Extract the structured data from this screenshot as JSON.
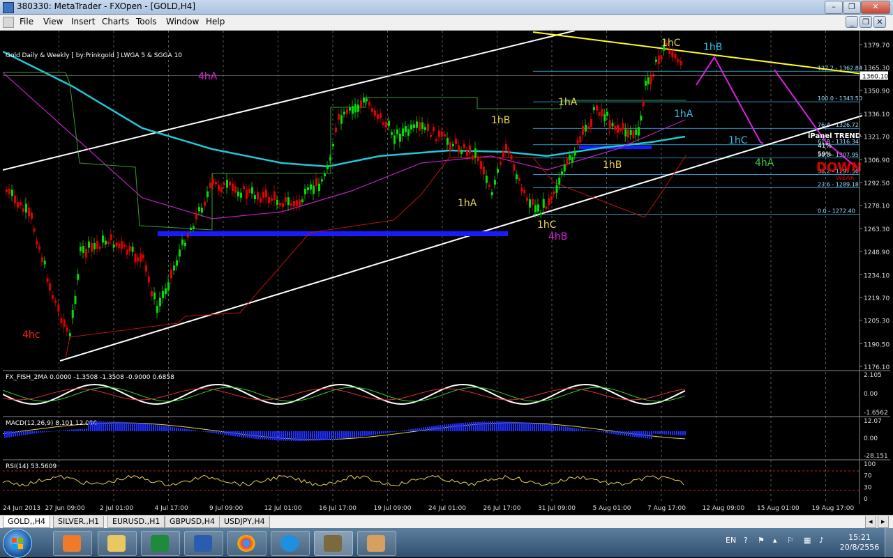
{
  "window": {
    "title": "380330: MetaTrader - FXOpen - [GOLD,H4]"
  },
  "menu": [
    "File",
    "View",
    "Insert",
    "Charts",
    "Tools",
    "Window",
    "Help"
  ],
  "chart": {
    "header": "Gold Daily & Weekly [ by:Prinkgold ] LWGA 5 & SGGA 10",
    "price_labels": [
      "1379.70",
      "1365.30",
      "1350.90",
      "1336.10",
      "1321.70",
      "1306.90",
      "1292.50",
      "1278.10",
      "1263.30",
      "1248.90",
      "1234.10",
      "1219.70",
      "1205.30",
      "1190.50",
      "1176.10"
    ],
    "current_price": "1360.10",
    "fib_levels": [
      {
        "label": "127.2 - 1362.84",
        "price": 1362.84
      },
      {
        "label": "100.0 - 1343.50",
        "price": 1343.5
      },
      {
        "label": "76.4 - 1326.72",
        "price": 1326.72
      },
      {
        "label": "61.8 - 1316.34",
        "price": 1316.34
      },
      {
        "label": "50.0 - 1307.95",
        "price": 1307.95
      },
      {
        "label": "38.2 - 1297.56",
        "price": 1297.56
      },
      {
        "label": "23.6 - 1289.18",
        "price": 1289.18
      },
      {
        "label": "0.0 - 1272.40",
        "price": 1272.4
      }
    ],
    "wave_labels": [
      {
        "text": "4hA",
        "color": "#e020e0"
      },
      {
        "text": "4hc",
        "color": "#ff2020"
      },
      {
        "text": "1hA",
        "color": "#e6d84a"
      },
      {
        "text": "1hB",
        "color": "#e6d84a"
      },
      {
        "text": "1hA",
        "color": "#e6d84a"
      },
      {
        "text": "1hC",
        "color": "#e6d84a"
      },
      {
        "text": "4hB",
        "color": "#e020e0"
      },
      {
        "text": "1hB",
        "color": "#e6d84a"
      },
      {
        "text": "1hC",
        "color": "#e6d84a"
      },
      {
        "text": "1hB",
        "color": "#2fc0e8"
      },
      {
        "text": "1hA",
        "color": "#2fc0e8"
      },
      {
        "text": "1hC",
        "color": "#2fc0e8"
      },
      {
        "text": "4hA",
        "color": "#33cc33"
      }
    ],
    "ipanel": {
      "title": "iPanel TREND",
      "pct1": "41%",
      "pct2": "59%",
      "signal": "DOWN",
      "strength": "WEAK"
    },
    "time_labels": [
      "24 Jun 2013",
      "27 Jun 09:00",
      "2 Jul 01:00",
      "4 Jul 17:00",
      "9 Jul 09:00",
      "12 Jul 01:00",
      "16 Jul 17:00",
      "19 Jul 09:00",
      "24 Jul 01:00",
      "26 Jul 17:00",
      "31 Jul 09:00",
      "5 Aug 01:00",
      "7 Aug 17:00",
      "12 Aug 09:00",
      "15 Aug 01:00",
      "19 Aug 17:00"
    ]
  },
  "indicators": {
    "fish": {
      "label": "FX_FISH_2MA 0.0000 -1.3508 -1.3508 -0.9000 0.6858",
      "scale": [
        "2.105",
        "0.00",
        "-1.6562"
      ]
    },
    "macd": {
      "label": "MACD(12,26,9) 8.101 12.090",
      "scale": [
        "12.07",
        "0.00",
        "-28.151"
      ]
    },
    "rsi": {
      "label": "RSI(14) 53.5609",
      "scale": [
        "100",
        "70",
        "30",
        "0"
      ]
    }
  },
  "tabs": [
    "GOLD,,H4",
    "SILVER.,H1",
    "EURUSD.,H1",
    "GBPUSD,H4",
    "USDJPY,H4"
  ],
  "tray": {
    "lang": "EN",
    "time": "15:21",
    "date": "20/8/2556"
  },
  "colors": {
    "bull": "#00e000",
    "bear": "#e00000",
    "support": "#1a1aff",
    "fib": "#30c8ff",
    "trend": "#ffffff",
    "resist": "#ffff20",
    "arrow": "#e020e0"
  }
}
